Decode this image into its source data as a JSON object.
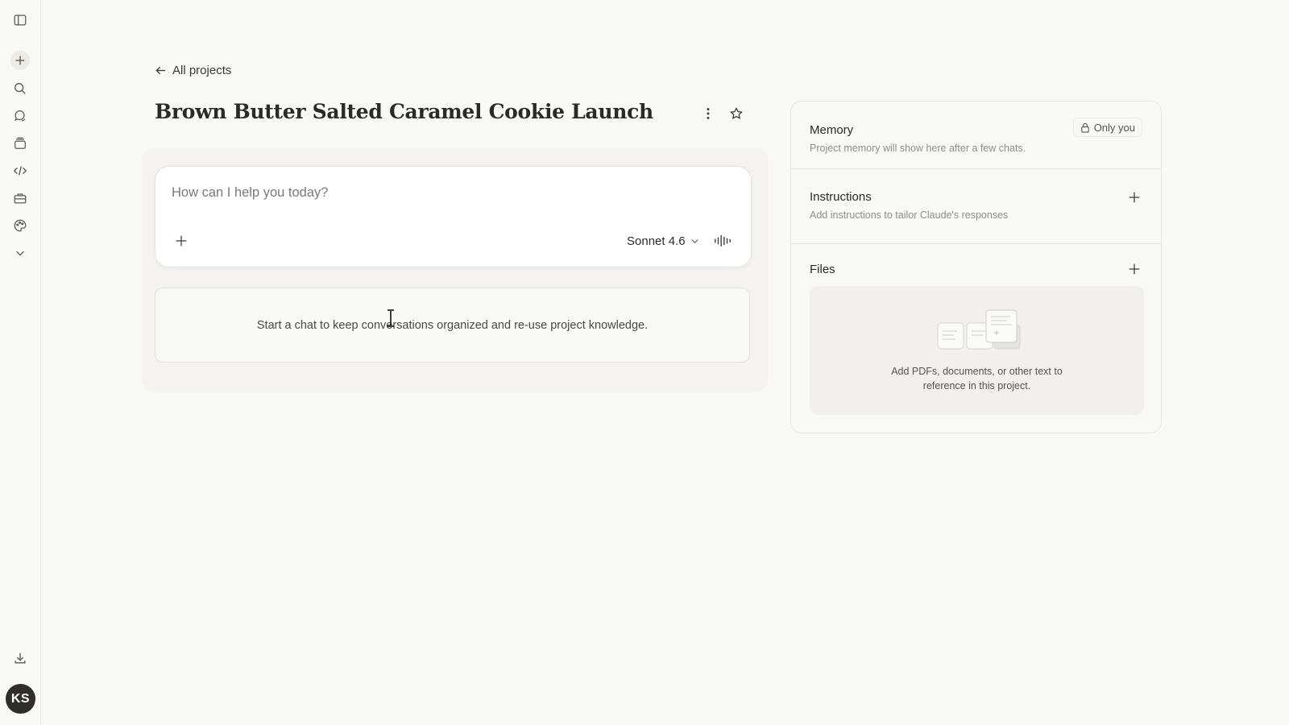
{
  "sidebar": {
    "icons": [
      {
        "name": "sidebar-toggle-icon"
      },
      {
        "name": "new-chat-icon"
      },
      {
        "name": "search-icon"
      },
      {
        "name": "chats-icon"
      },
      {
        "name": "projects-icon"
      },
      {
        "name": "code-icon"
      },
      {
        "name": "toolbox-icon"
      },
      {
        "name": "palette-icon"
      },
      {
        "name": "chevron-down-icon"
      },
      {
        "name": "download-icon"
      }
    ],
    "avatar_initials": "KS"
  },
  "header": {
    "back_label": "All projects",
    "title": "Brown Butter Salted Caramel Cookie Launch"
  },
  "composer": {
    "placeholder": "How can I help you today?",
    "model_label": "Sonnet 4.6"
  },
  "empty_state": {
    "message": "Start a chat to keep conversations organized and re-use project knowledge."
  },
  "panel": {
    "memory": {
      "title": "Memory",
      "visibility_label": "Only you",
      "description": "Project memory will show here after a few chats."
    },
    "instructions": {
      "title": "Instructions",
      "description": "Add instructions to tailor Claude's responses"
    },
    "files": {
      "title": "Files",
      "empty_line1": "Add PDFs, documents, or other text to",
      "empty_line2": "reference in this project."
    }
  }
}
